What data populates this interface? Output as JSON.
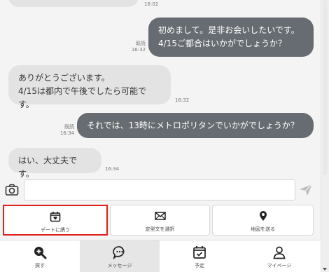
{
  "messages": [
    {
      "id": "m0",
      "time": "16:02"
    },
    {
      "id": "m1",
      "direction": "out",
      "text": "初めまして。是非お会いしたいです。\n4/15ご都合はいかがでしょうか？",
      "read": "既読",
      "time": "16:32"
    },
    {
      "id": "m2",
      "direction": "in",
      "text": "ありがとうございます。\n4/15は都内で午後でしたら可能です。",
      "time": "16:32"
    },
    {
      "id": "m3",
      "direction": "out",
      "text": "それでは、13時にメトロポリタンでいかがでしょうか？",
      "read": "既読",
      "time": "16:34"
    },
    {
      "id": "m4",
      "direction": "in",
      "text": "はい、大丈夫です。",
      "time": "16:34"
    }
  ],
  "composer": {
    "placeholder": "",
    "value": ""
  },
  "actions": [
    {
      "label": "デートに誘う",
      "icon": "calendar-heart-icon",
      "selected": true,
      "highlight_color": "#e0201a"
    },
    {
      "label": "定型文を選択",
      "icon": "envelope-icon"
    },
    {
      "label": "地図を送る",
      "icon": "map-pin-icon"
    }
  ],
  "tabs": [
    {
      "label": "探す",
      "icon": "search-plus-icon"
    },
    {
      "label": "メッセージ",
      "icon": "chat-bubble-icon",
      "active": true
    },
    {
      "label": "予定",
      "icon": "calendar-check-icon"
    },
    {
      "label": "マイページ",
      "icon": "user-icon"
    }
  ],
  "colors": {
    "outgoing_bubble": "#666c71",
    "incoming_bubble": "#e3e3e3",
    "accent_red": "#e0201a"
  }
}
